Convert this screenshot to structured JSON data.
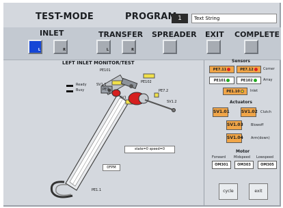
{
  "header": {
    "mode_title": "TEST-MODE",
    "program_label": "PROGRAM",
    "program_number": "1",
    "program_text": "Text String"
  },
  "tabs": {
    "inlet": "INLET",
    "transfer": "TRANSFER",
    "spreader": "SPREADER",
    "exit": "EXIT",
    "complete": "COMPLETE",
    "btn_l": "L",
    "btn_r": "R"
  },
  "main": {
    "title": "LEFT INLET MONITOR/TEST",
    "legend_ready": "Ready",
    "legend_busy": "Busy",
    "state_text": "state=0 speed=0",
    "fpm_text": "0FPM",
    "labels": {
      "pe101": "PE101",
      "pe102": "PE102",
      "sv11": "SV1.1",
      "sv12": "SV1.2",
      "pe72": "PE7.2",
      "pe7": "PE7",
      "sv1": "SV1",
      "pe11": "PE1.1"
    }
  },
  "sensors": {
    "title": "Sensors",
    "pe711": "PE7.11",
    "pe712": "PE7.12",
    "corner": "Corner",
    "pe101": "PE101",
    "pe102": "PE102",
    "array": "Array",
    "pe110": "PE1.10",
    "inlet": "Inlet"
  },
  "actuators": {
    "title": "Actuators",
    "sv101": "SV1.01",
    "sv102": "SV1.02",
    "clutch": "Clutch",
    "sv103": "SV1.03",
    "blowoff": "Blowoff",
    "sv104": "SV1.04",
    "arm": "Arm(down)"
  },
  "motor": {
    "title": "Motor",
    "forward": "Forward",
    "midspeed": "Midspeed",
    "lowspeed": "Lowspeed",
    "om301": "OM301",
    "om303": "OM303",
    "om305": "OM305"
  },
  "controls": {
    "cycle": "cycle",
    "exit": "exit"
  },
  "colors": {
    "active_blue": "#1546d6",
    "actuator_orange": "#f0a548",
    "indicator_red": "#d22",
    "indicator_green": "#2a2",
    "indicator_yellow": "#f6c700"
  }
}
